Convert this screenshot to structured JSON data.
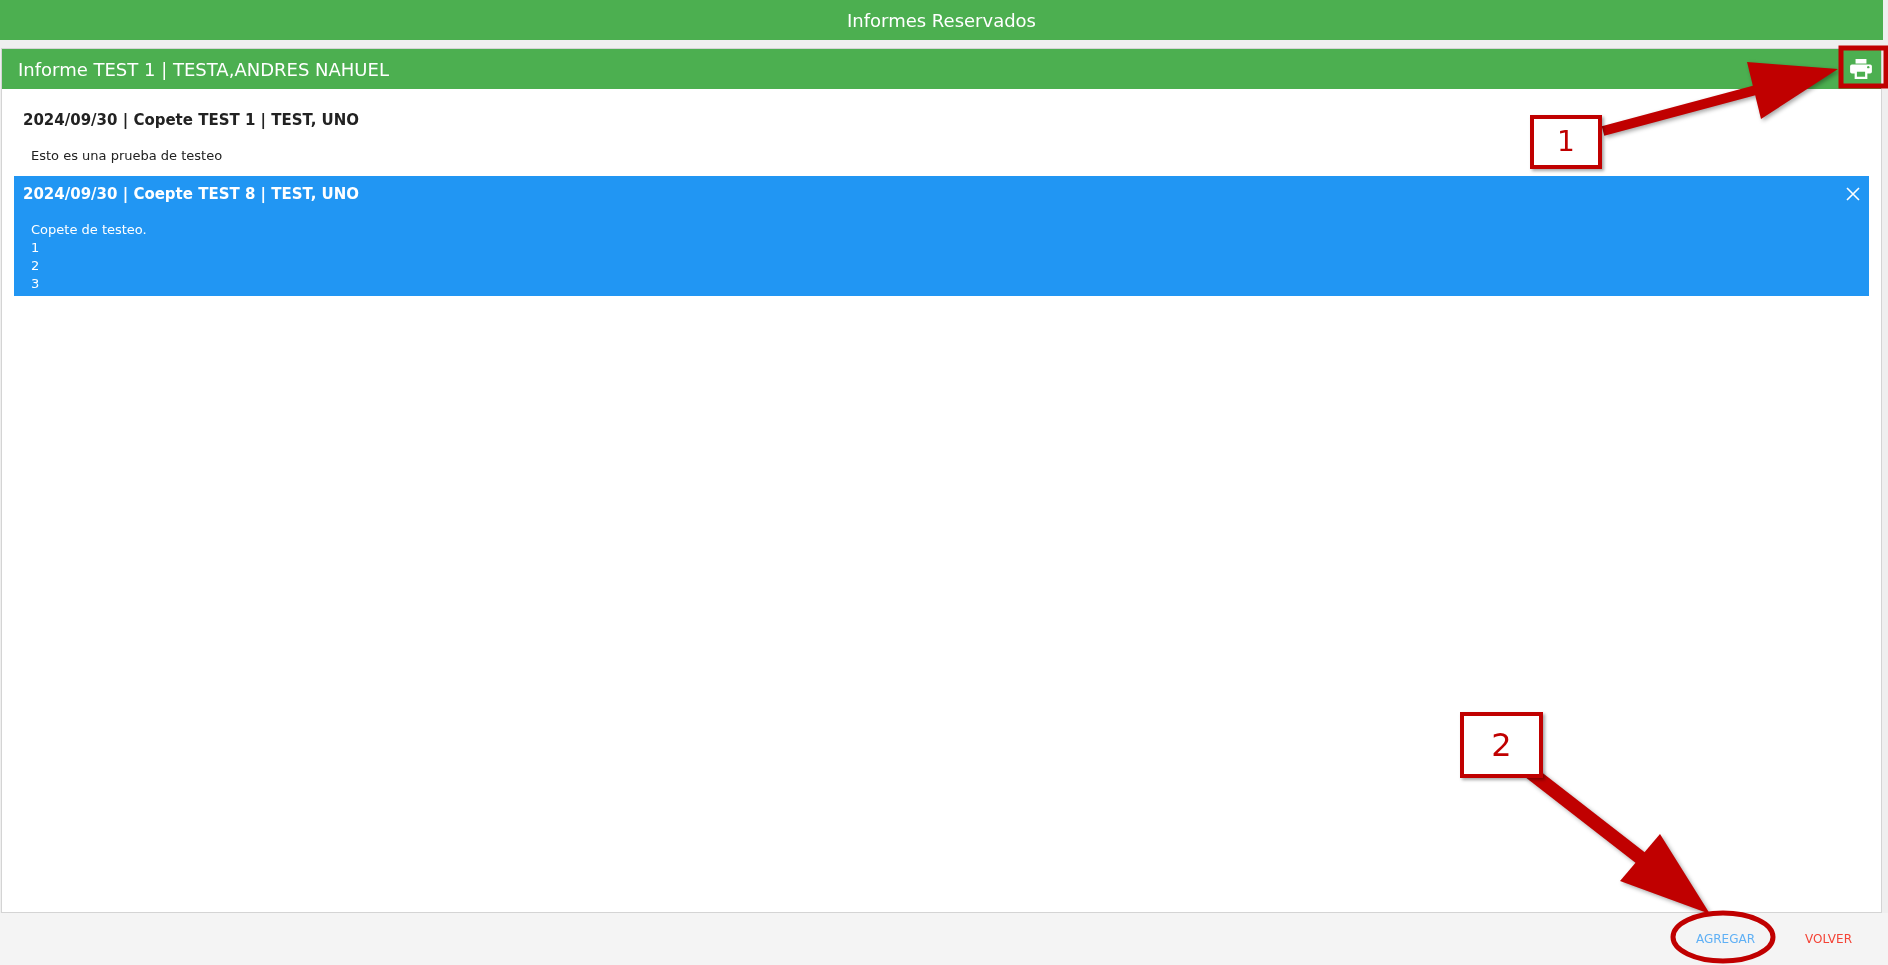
{
  "header": {
    "title": "Informes Reservados"
  },
  "report": {
    "title": "Informe TEST 1 | TESTA,ANDRES NAHUEL",
    "entries": [
      {
        "heading": "2024/09/30 | Copete TEST 1 | TEST, UNO",
        "body": "Esto es una prueba de testeo",
        "selected": false
      },
      {
        "heading": "2024/09/30 | Coepte TEST 8 | TEST, UNO",
        "body": "Copete de testeo.\n1\n2\n3",
        "selected": true
      }
    ]
  },
  "footer": {
    "buttons": [
      {
        "label": "AGREGAR",
        "kind": "primary"
      },
      {
        "label": "VOLVER",
        "kind": "cancel"
      }
    ]
  },
  "annotations": [
    {
      "label": "1",
      "kind": "rectangle"
    },
    {
      "label": "2",
      "kind": "ellipse"
    }
  ]
}
